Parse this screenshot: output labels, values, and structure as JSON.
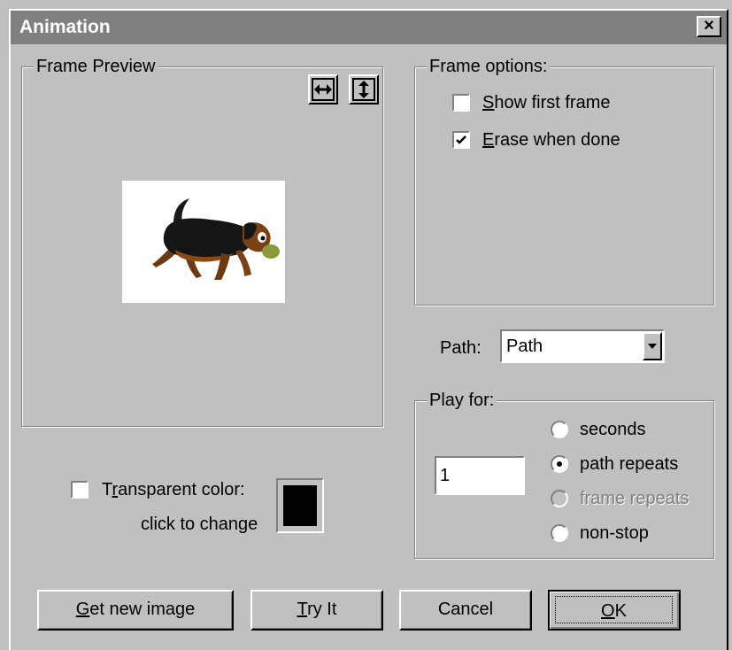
{
  "window": {
    "title": "Animation",
    "close_label": "×"
  },
  "frame_preview": {
    "legend": "Frame Preview",
    "flip_horizontal_icon": "flip-horizontal-icon",
    "flip_vertical_icon": "flip-vertical-icon",
    "image": "dog-image"
  },
  "frame_options": {
    "legend": "Frame options:",
    "show_first_frame": {
      "label": "Show first frame",
      "mnemonic": "S",
      "rest": "how first frame",
      "checked": false
    },
    "erase_when_done": {
      "label": "Erase when done",
      "mnemonic": "E",
      "rest": "rase when done",
      "checked": true
    }
  },
  "path": {
    "label": "Path:",
    "selected": "Path"
  },
  "play_for": {
    "legend": "Play for:",
    "value": "1",
    "options": [
      {
        "label": "seconds",
        "selected": false,
        "enabled": true
      },
      {
        "label": "path repeats",
        "selected": true,
        "enabled": true
      },
      {
        "label": "frame repeats",
        "selected": false,
        "enabled": false
      },
      {
        "label": "non-stop",
        "selected": false,
        "enabled": true
      }
    ]
  },
  "transparent": {
    "label_pre": "T",
    "label_mnemonic": "r",
    "label_post": "ansparent color:",
    "hint": "click to change",
    "checked": false,
    "color": "#000000"
  },
  "buttons": {
    "get_new_image": {
      "label": "Get new image",
      "mnemonic": "G",
      "rest": "et new image"
    },
    "try_it": {
      "label": "Try It",
      "mnemonic": "T",
      "rest": "ry It"
    },
    "cancel": {
      "label": "Cancel"
    },
    "ok": {
      "label": "OK",
      "mnemonic": "O",
      "rest": "K"
    }
  },
  "colors": {
    "face": "#c0c0c0",
    "titlebar": "#808080",
    "shadow": "#808080",
    "highlight": "#ffffff"
  }
}
